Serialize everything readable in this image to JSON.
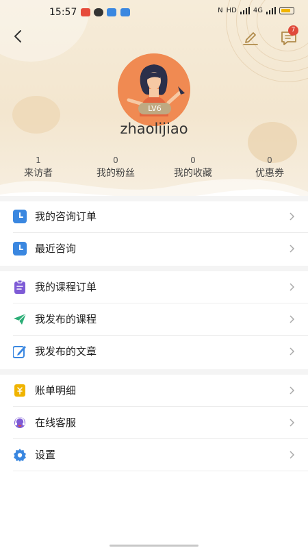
{
  "status_bar": {
    "time": "15:57",
    "network_text": "HD",
    "signal_text": "4G",
    "battery_color": "#f0b400"
  },
  "header": {
    "back_icon": "chevron-left-icon",
    "edit_icon": "pencil-icon",
    "message_icon": "message-icon",
    "message_badge": "7"
  },
  "profile": {
    "username": "zhaolijiao",
    "level": "LV6",
    "avatar_color": "#f08a52"
  },
  "stats": [
    {
      "value": "1",
      "label": "来访者"
    },
    {
      "value": "0",
      "label": "我的粉丝"
    },
    {
      "value": "0",
      "label": "我的收藏"
    },
    {
      "value": "0",
      "label": "优惠券"
    }
  ],
  "menu": {
    "group1": [
      {
        "label": "我的咨询订单",
        "icon": "clock-icon",
        "color": "#3a87e0"
      },
      {
        "label": "最近咨询",
        "icon": "clock-icon",
        "color": "#3a87e0"
      }
    ],
    "group2": [
      {
        "label": "我的课程订单",
        "icon": "clipboard-icon",
        "color": "#7e5bd6"
      },
      {
        "label": "我发布的课程",
        "icon": "paper-plane-icon",
        "color": "#2cae77"
      },
      {
        "label": "我发布的文章",
        "icon": "edit-square-icon",
        "color": "#3a87e0"
      }
    ],
    "group3": [
      {
        "label": "账单明细",
        "icon": "bill-icon",
        "color": "#f0b400"
      },
      {
        "label": "在线客服",
        "icon": "headset-icon",
        "color": "#7e5bd6"
      },
      {
        "label": "设置",
        "icon": "gear-icon",
        "color": "#3a87e0"
      }
    ]
  }
}
